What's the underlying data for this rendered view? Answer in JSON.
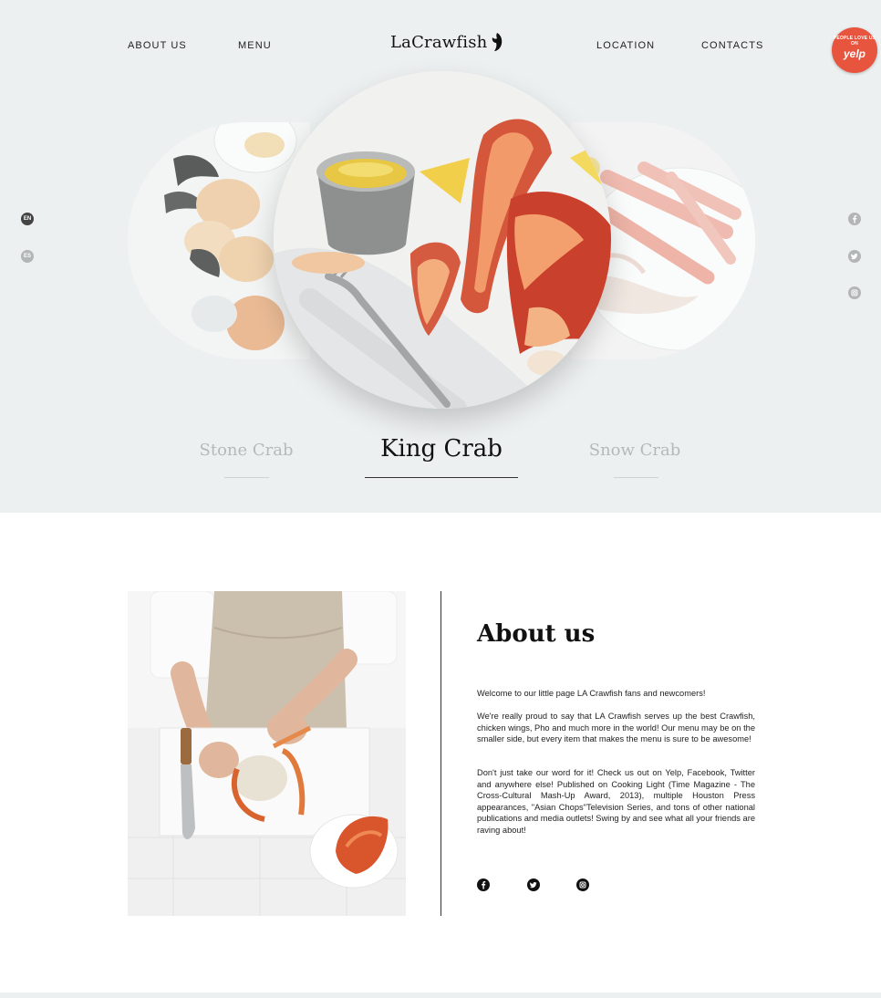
{
  "nav": {
    "about": "ABOUT US",
    "menu": "MENU",
    "location": "LOCATION",
    "contacts": "CONTACTS"
  },
  "logo": {
    "text": "LaCrawfish",
    "icon": "crawfish-claw-icon"
  },
  "yelp_badge": {
    "top_text": "PEOPLE LOVE US ON",
    "brand": "yelp"
  },
  "languages": {
    "en": "EN",
    "es": "ES"
  },
  "social_icons": [
    "facebook-icon",
    "twitter-icon",
    "instagram-icon"
  ],
  "carousel": {
    "items": [
      {
        "label": "Stone Crab"
      },
      {
        "label": "King Crab"
      },
      {
        "label": "Snow Crab"
      }
    ],
    "active_index": 1
  },
  "about": {
    "title": "About us",
    "paragraphs": [
      "Welcome to our little page LA Crawfish fans and newcomers!",
      "We're really proud to say that LA Crawfish serves up the best Crawfish, chicken wings, Pho and much more in the world! Our menu may be on the smaller side, but every item that makes the menu is sure to be awesome!",
      "Don't just take our word for it! Check us out on Yelp, Facebook, Twitter and anywhere else! Published on Cooking Light (Time Magazine - The Cross-Cultural Mash-Up Award, 2013), multiple Houston Press appearances, \"Asian Chops\"Television Series, and tons of other national publications and media outlets! Swing by and see what all your friends are raving about!"
    ]
  },
  "colors": {
    "hero_background": "#edf0f1",
    "yelp_red": "#e8553f",
    "muted_label": "#b6b9ba",
    "text_dark": "#111111"
  }
}
